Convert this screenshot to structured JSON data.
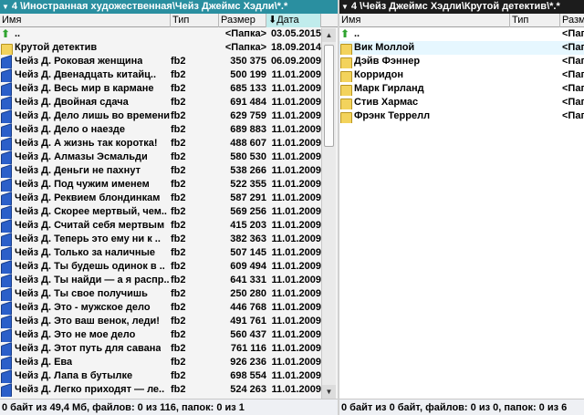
{
  "left": {
    "path": "4 \\Иностранная художественная\\Чейз Джеймс Хэдли\\*.*",
    "columns": {
      "name": "Имя",
      "type": "Тип",
      "size": "Размер",
      "date": "Дата"
    },
    "rows": [
      {
        "icon": "up-icon",
        "name": "..",
        "type": "",
        "size": "<Папка>",
        "date": "03.05.2015"
      },
      {
        "icon": "folder-icon",
        "name": "Крутой детектив",
        "type": "",
        "size": "<Папка>",
        "date": "18.09.2014"
      },
      {
        "icon": "book-icon",
        "name": "Чейз Д. Роковая женщина",
        "type": "fb2",
        "size": "350 375",
        "date": "06.09.2009"
      },
      {
        "icon": "book-icon",
        "name": "Чейз Д. Двенадцать китайц..",
        "type": "fb2",
        "size": "500 199",
        "date": "11.01.2009"
      },
      {
        "icon": "book-icon",
        "name": "Чейз Д. Весь мир в кармане",
        "type": "fb2",
        "size": "685 133",
        "date": "11.01.2009"
      },
      {
        "icon": "book-icon",
        "name": "Чейз Д. Двойная сдача",
        "type": "fb2",
        "size": "691 484",
        "date": "11.01.2009"
      },
      {
        "icon": "book-icon",
        "name": "Чейз Д. Дело лишь во времени",
        "type": "fb2",
        "size": "629 759",
        "date": "11.01.2009"
      },
      {
        "icon": "book-icon",
        "name": "Чейз Д. Дело о наезде",
        "type": "fb2",
        "size": "689 883",
        "date": "11.01.2009"
      },
      {
        "icon": "book-icon",
        "name": "Чейз Д. А жизнь так коротка!",
        "type": "fb2",
        "size": "488 607",
        "date": "11.01.2009"
      },
      {
        "icon": "book-icon",
        "name": "Чейз Д. Алмазы Эсмальди",
        "type": "fb2",
        "size": "580 530",
        "date": "11.01.2009"
      },
      {
        "icon": "book-icon",
        "name": "Чейз Д. Деньги не пахнут",
        "type": "fb2",
        "size": "538 266",
        "date": "11.01.2009"
      },
      {
        "icon": "book-icon",
        "name": "Чейз Д. Под чужим именем",
        "type": "fb2",
        "size": "522 355",
        "date": "11.01.2009"
      },
      {
        "icon": "book-icon",
        "name": "Чейз Д. Реквием блондинкам",
        "type": "fb2",
        "size": "587 291",
        "date": "11.01.2009"
      },
      {
        "icon": "book-icon",
        "name": "Чейз Д. Скорее мертвый, чем..",
        "type": "fb2",
        "size": "569 256",
        "date": "11.01.2009"
      },
      {
        "icon": "book-icon",
        "name": "Чейз Д. Считай себя мертвым",
        "type": "fb2",
        "size": "415 203",
        "date": "11.01.2009"
      },
      {
        "icon": "book-icon",
        "name": "Чейз Д. Теперь это ему ни к ..",
        "type": "fb2",
        "size": "382 363",
        "date": "11.01.2009"
      },
      {
        "icon": "book-icon",
        "name": "Чейз Д. Только за наличные",
        "type": "fb2",
        "size": "507 145",
        "date": "11.01.2009"
      },
      {
        "icon": "book-icon",
        "name": "Чейз Д. Ты будешь одинок в ..",
        "type": "fb2",
        "size": "609 494",
        "date": "11.01.2009"
      },
      {
        "icon": "book-icon",
        "name": "Чейз Д. Ты найди — а я распр..",
        "type": "fb2",
        "size": "641 331",
        "date": "11.01.2009"
      },
      {
        "icon": "book-icon",
        "name": "Чейз Д. Ты свое получишь",
        "type": "fb2",
        "size": "250 280",
        "date": "11.01.2009"
      },
      {
        "icon": "book-icon",
        "name": "Чейз Д. Это - мужское дело",
        "type": "fb2",
        "size": "446 768",
        "date": "11.01.2009"
      },
      {
        "icon": "book-icon",
        "name": "Чейз Д. Это ваш венок, леди!",
        "type": "fb2",
        "size": "491 761",
        "date": "11.01.2009"
      },
      {
        "icon": "book-icon",
        "name": "Чейз Д. Это не мое дело",
        "type": "fb2",
        "size": "560 437",
        "date": "11.01.2009"
      },
      {
        "icon": "book-icon",
        "name": "Чейз Д. Этот путь для савана",
        "type": "fb2",
        "size": "761 116",
        "date": "11.01.2009"
      },
      {
        "icon": "book-icon",
        "name": "Чейз Д. Ева",
        "type": "fb2",
        "size": "926 236",
        "date": "11.01.2009"
      },
      {
        "icon": "book-icon",
        "name": "Чейз Д. Лапа в бутылке",
        "type": "fb2",
        "size": "698 554",
        "date": "11.01.2009"
      },
      {
        "icon": "book-icon",
        "name": "Чейз Д. Легко приходят — ле..",
        "type": "fb2",
        "size": "524 263",
        "date": "11.01.2009"
      }
    ],
    "status": "0 байт из 49,4 Мб, файлов: 0 из 116, папок: 0 из 1"
  },
  "right": {
    "path": "4 \\Чейз Джеймс Хэдли\\Крутой детектив\\*.*",
    "columns": {
      "name": "Имя",
      "type": "Тип",
      "size": "Размер"
    },
    "rows": [
      {
        "icon": "up-icon",
        "name": "..",
        "size": "<Пап"
      },
      {
        "icon": "folder-icon",
        "name": "Вик Моллой",
        "size": "<Пап",
        "selected": true
      },
      {
        "icon": "folder-icon",
        "name": "Дэйв Фэннер",
        "size": "<Пап"
      },
      {
        "icon": "folder-icon",
        "name": "Корридон",
        "size": "<Пап"
      },
      {
        "icon": "folder-icon",
        "name": "Марк Гирланд",
        "size": "<Пап"
      },
      {
        "icon": "folder-icon",
        "name": "Стив Хармас",
        "size": "<Пап"
      },
      {
        "icon": "folder-icon",
        "name": "Фрэнк Террелл",
        "size": "<Пап"
      }
    ],
    "status": "0 байт из 0 байт, файлов: 0 из 0, папок: 0 из 6"
  },
  "icons": {
    "sort": "sort-down-arrow-icon",
    "path_arrow": "dropdown-triangle-icon",
    "scroll_up": "scroll-up-icon",
    "scroll_down": "scroll-down-icon"
  },
  "colors": {
    "left_path_bar": "#2a8fa0",
    "right_path_bar": "#1c1c1c",
    "sorted_column": "#c0ecec",
    "folder": "#f3d35c",
    "book": "#2b5fc9",
    "up_arrow": "#2fa32f"
  }
}
